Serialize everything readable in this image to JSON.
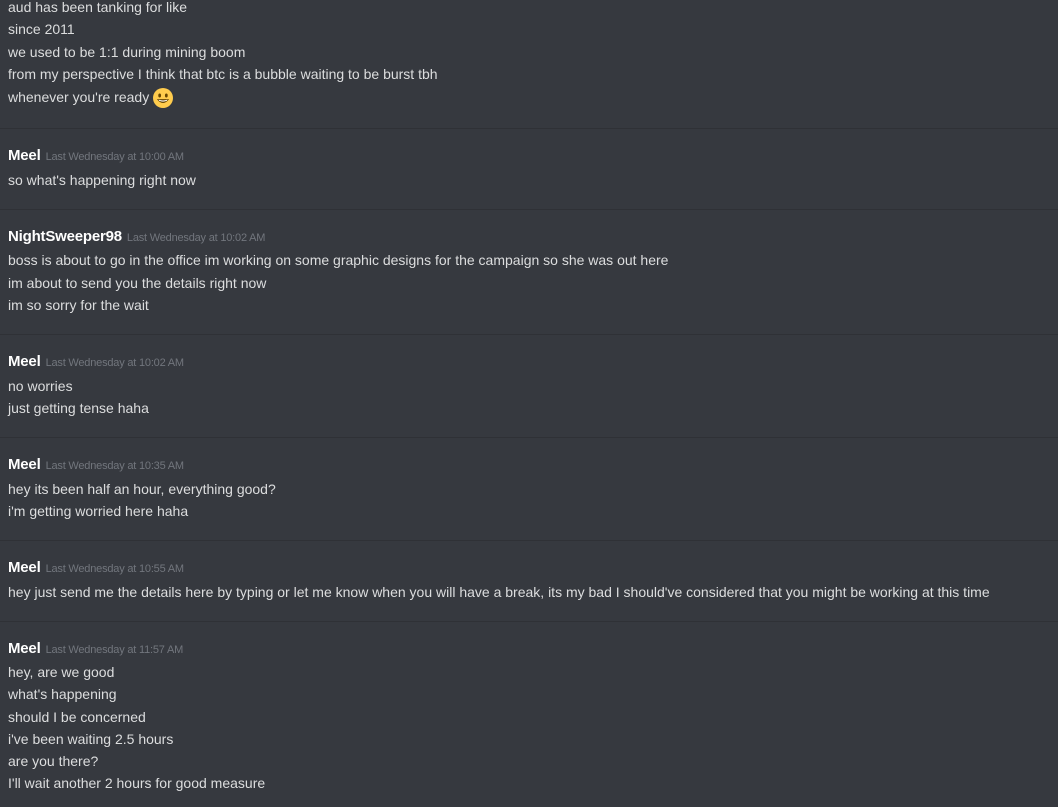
{
  "emoji": {
    "name": "smiley-face-emoji",
    "color": "#ffcc4d"
  },
  "groups": [
    {
      "lines": [
        "aud has been tanking for like",
        "since 2011",
        "we used to be 1:1 during mining boom",
        "from my perspective I think that btc is a bubble waiting to be burst tbh",
        "whenever you're ready"
      ]
    },
    {
      "username": "Meel",
      "timestamp": "Last Wednesday at 10:00 AM",
      "lines": [
        "so what's happening right now"
      ]
    },
    {
      "username": "NightSweeper98",
      "timestamp": "Last Wednesday at 10:02 AM",
      "lines": [
        "boss is about to go in the office im working on some graphic designs for the campaign so she was out here",
        "im about to send you the details right now",
        "im so sorry for the wait"
      ]
    },
    {
      "username": "Meel",
      "timestamp": "Last Wednesday at 10:02 AM",
      "lines": [
        "no worries",
        "just getting tense haha"
      ]
    },
    {
      "username": "Meel",
      "timestamp": "Last Wednesday at 10:35 AM",
      "lines": [
        "hey its been half an hour, everything good?",
        "i'm getting worried here haha"
      ]
    },
    {
      "username": "Meel",
      "timestamp": "Last Wednesday at 10:55 AM",
      "lines": [
        "hey just send me the details here by typing or let me know when you will have a break, its my bad I should've considered that you might be working at this time"
      ]
    },
    {
      "username": "Meel",
      "timestamp": "Last Wednesday at 11:57 AM",
      "lines": [
        "hey, are we good",
        "what's happening",
        "should I be concerned",
        "i've been waiting 2.5 hours",
        "are you there?",
        "I'll wait another 2 hours for good measure"
      ]
    }
  ]
}
